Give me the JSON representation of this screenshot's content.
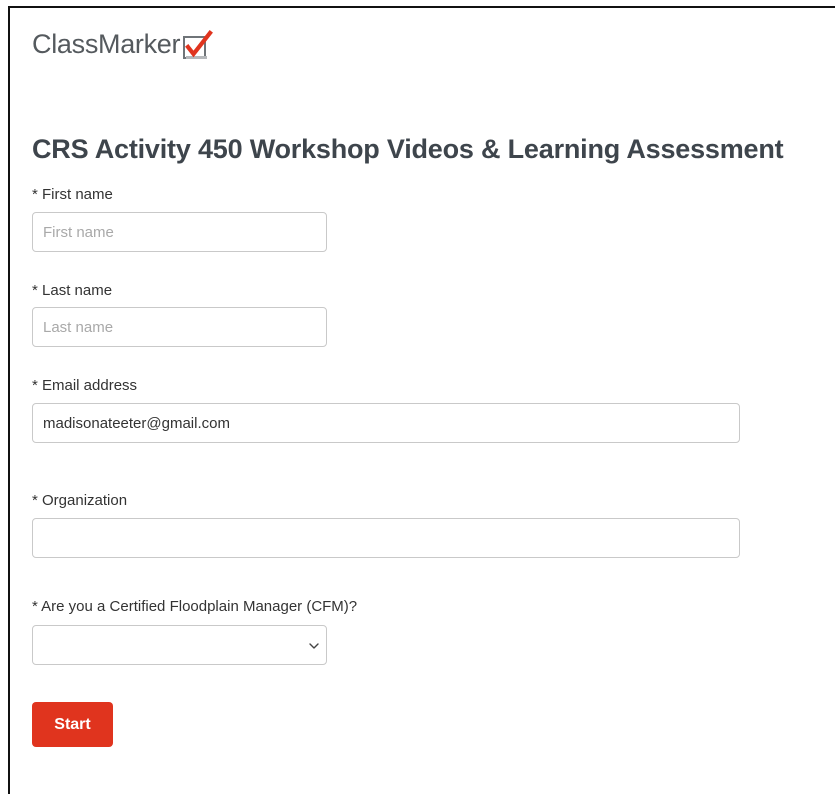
{
  "brand": {
    "name": "ClassMarker",
    "check_color": "#e0341e",
    "icon": "checkbox-check-icon"
  },
  "form": {
    "title": "CRS Activity 450 Workshop Videos & Learning Assessment",
    "first_name": {
      "label": "* First name",
      "placeholder": "First name",
      "value": ""
    },
    "last_name": {
      "label": "* Last name",
      "placeholder": "Last name",
      "value": ""
    },
    "email": {
      "label": "* Email address",
      "placeholder": "",
      "value": "madisonateeter@gmail.com"
    },
    "organization": {
      "label": "* Organization",
      "placeholder": "",
      "value": ""
    },
    "cfm": {
      "label": "* Are you a Certified Floodplain Manager (CFM)?",
      "selected": ""
    },
    "start_label": "Start",
    "start_color": "#e0341e"
  }
}
